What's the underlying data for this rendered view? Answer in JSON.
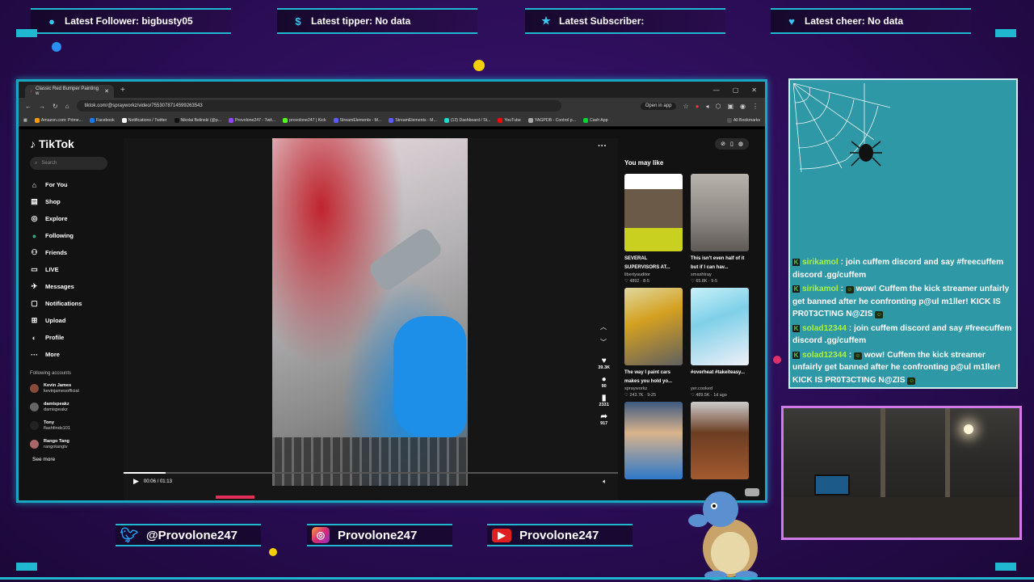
{
  "overlay": {
    "alerts": [
      {
        "icon": "person-icon",
        "text": "Latest Follower: bigbusty05"
      },
      {
        "icon": "dollar-icon",
        "text": "Latest tipper: No data"
      },
      {
        "icon": "star-icon",
        "text": "Latest Subscriber:"
      },
      {
        "icon": "heart-icon",
        "text": "Latest cheer: No data"
      }
    ],
    "social": {
      "twitter": "@Provolone247",
      "instagram": "Provolone247",
      "youtube": "Provolone247"
    },
    "accent_color": "#20b8d0",
    "background_color": "#2a0d55"
  },
  "browser": {
    "tab_title": "Classic Red Bumper Painting w",
    "url": "tiktok.com/@sprayworkz/video/7553078714599263543",
    "open_in_app": "Open in app",
    "bookmarks": [
      "Amazon.com: Prime...",
      "Facebook",
      "Notifications / Twitter",
      "Nikolai Belinski (@p...",
      "Provolone247 - Twit...",
      "provolone247 | Kick",
      "StreamElements - M...",
      "StreamElements - M...",
      "(13) Dashboard / St...",
      "YouTube",
      "YAGPDB - Control p...",
      "Cash App"
    ],
    "all_bookmarks": "All Bookmarks"
  },
  "tiktok": {
    "logo": "TikTok",
    "search_placeholder": "Search",
    "nav": [
      {
        "icon": "home-icon",
        "label": "For You"
      },
      {
        "icon": "shop-icon",
        "label": "Shop"
      },
      {
        "icon": "compass-icon",
        "label": "Explore"
      },
      {
        "icon": "following-icon",
        "label": "Following"
      },
      {
        "icon": "friends-icon",
        "label": "Friends"
      },
      {
        "icon": "live-icon",
        "label": "LIVE"
      },
      {
        "icon": "messages-icon",
        "label": "Messages"
      },
      {
        "icon": "notifications-icon",
        "label": "Notifications"
      },
      {
        "icon": "upload-icon",
        "label": "Upload"
      },
      {
        "icon": "profile-icon",
        "label": "Profile"
      },
      {
        "icon": "more-icon",
        "label": "More"
      }
    ],
    "following_header": "Following accounts",
    "following": [
      {
        "name": "Kevin James",
        "handle": "kevinjamesofficial"
      },
      {
        "name": "damispeakz",
        "handle": "damispeakz"
      },
      {
        "name": "Tony",
        "handle": "flashfinds101"
      },
      {
        "name": "Rango Tang",
        "handle": "rangotangtv"
      }
    ],
    "see_more": "See more",
    "player": {
      "time": "00:06 / 01:13",
      "progress_fraction": 0.085,
      "likes": "39.3K",
      "comments": "90",
      "saves": "2331",
      "shares": "917"
    },
    "recommended_title": "You may like",
    "recommended": [
      {
        "caption": "SEVERAL SUPERVISORS AT...",
        "user": "libertyauditor",
        "meta": "♡ 4892 · 8-5"
      },
      {
        "caption": "This isn't even half of it but if I can hav...",
        "user": "smashtray",
        "meta": "♡ 65.8K · 9-5"
      },
      {
        "caption": "The way I paint cars makes you hold yo...",
        "user": "sprayworkz",
        "meta": "♡ 243.7K · 9-25"
      },
      {
        "caption": "#overheat #takeiteasy...",
        "user": "yer.cooked",
        "meta": "♡ 489.5K · 1d ago"
      },
      {
        "caption": "",
        "user": "",
        "meta": ""
      },
      {
        "caption": "",
        "user": "",
        "meta": ""
      }
    ]
  },
  "chat": {
    "messages": [
      {
        "user": "sirikamol",
        "text": ": join cuffem discord and say #freecuffem discord .gg/cuffem",
        "emote": false
      },
      {
        "user": "sirikamol",
        "text": "wow! Cuffem the kick streamer unfairly get banned after he confronting p@ul m1ller! KICK IS PR0T3CTING N@ZIS",
        "emote": true
      },
      {
        "user": "solad12344",
        "text": ": join cuffem discord and say #freecuffem discord .gg/cuffem",
        "emote": false
      },
      {
        "user": "solad12344",
        "text": "wow! Cuffem the kick streamer unfairly get banned after he confronting p@ul m1ller! KICK IS PR0T3CTING N@ZIS",
        "emote": true
      }
    ]
  }
}
